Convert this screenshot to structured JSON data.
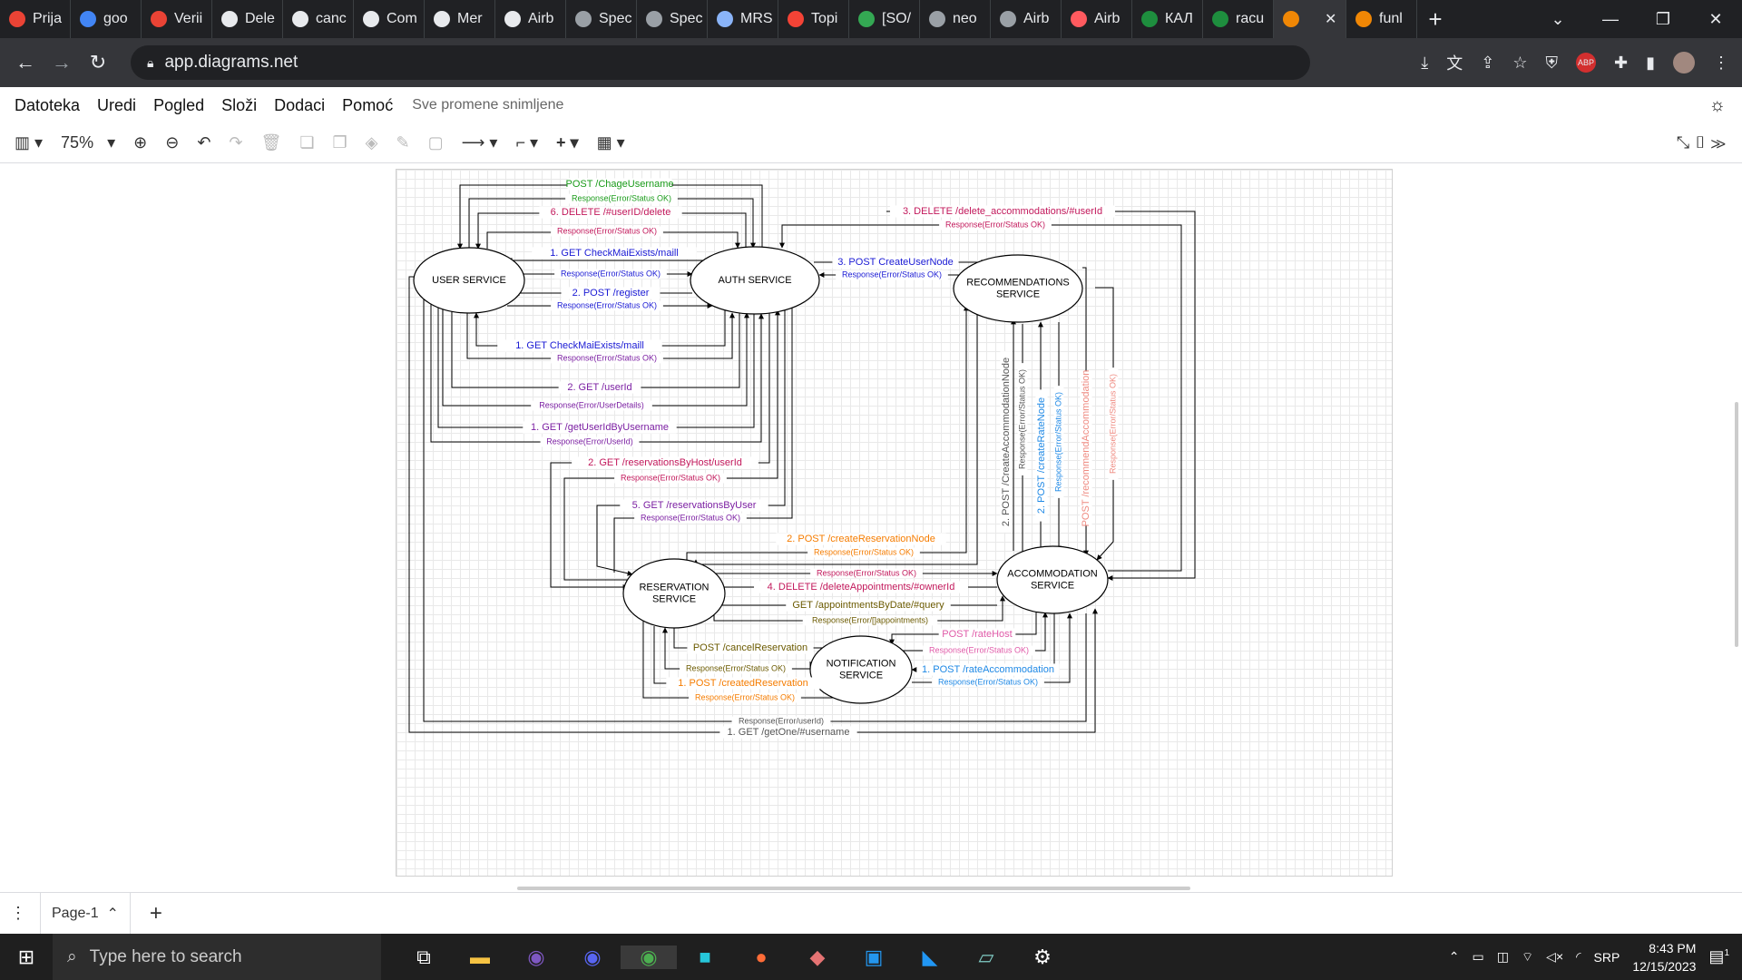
{
  "browser": {
    "tabs": [
      {
        "label": "Prija",
        "color": "#ea4335"
      },
      {
        "label": "goo",
        "color": "#4285f4"
      },
      {
        "label": "Verii",
        "color": "#ea4335"
      },
      {
        "label": "Dele",
        "color": "#e8eaed"
      },
      {
        "label": "canc",
        "color": "#e8eaed"
      },
      {
        "label": "Com",
        "color": "#e8eaed"
      },
      {
        "label": "Mer",
        "color": "#e8eaed"
      },
      {
        "label": "Airb",
        "color": "#e8eaed"
      },
      {
        "label": "Spec",
        "color": "#9aa0a6"
      },
      {
        "label": "Spec",
        "color": "#9aa0a6"
      },
      {
        "label": "MRS",
        "color": "#8ab4f8"
      },
      {
        "label": "Topi",
        "color": "#f44336"
      },
      {
        "label": "[SO/",
        "color": "#34a853"
      },
      {
        "label": "neo",
        "color": "#9aa0a6"
      },
      {
        "label": "Airb",
        "color": "#9aa0a6"
      },
      {
        "label": "Airb",
        "color": "#ff5a5f"
      },
      {
        "label": "КАЛ",
        "color": "#1e8e3e"
      },
      {
        "label": "racu",
        "color": "#1e8e3e"
      },
      {
        "label": "",
        "color": "#f08705"
      },
      {
        "label": "funl",
        "color": "#f08705"
      }
    ],
    "url": "app.diagrams.net"
  },
  "menu": {
    "items": [
      "Datoteka",
      "Uredi",
      "Pogled",
      "Složi",
      "Dodaci",
      "Pomoć"
    ],
    "saved_status": "Sve promene snimljene"
  },
  "toolbar": {
    "zoom": "75%"
  },
  "diagram": {
    "nodes": {
      "user": "USER SERVICE",
      "auth": "AUTH SERVICE",
      "reco": [
        "RECOMMENDATIONS",
        "SERVICE"
      ],
      "reservation": [
        "RESERVATION",
        "SERVICE"
      ],
      "accommodation": [
        "ACCOMMODATION",
        "SERVICE"
      ],
      "notification": [
        "NOTIFICATION",
        "SERVICE"
      ]
    },
    "labels": {
      "chage_username": "POST /ChageUsername",
      "chage_username_resp": "Response(Error/Status OK)",
      "delete_user": "6.  DELETE /#userID/delete",
      "delete_user_resp": "Response(Error/Status OK)",
      "check_mail_1": "1.  GET   CheckMaiExists/maill",
      "check_mail_1_resp": "Response(Error/Status OK)",
      "register": "2.  POST /register",
      "register_resp": "Response(Error/Status OK)",
      "check_mail_2": "1.  GET   CheckMaiExists/maill",
      "check_mail_2_resp": "Response(Error/Status OK)",
      "get_userid": "2.  GET /userId",
      "get_userid_resp": "Response(Error/UserDetails)",
      "get_userid_by_username": "1.  GET /getUserIdByUsername",
      "get_userid_by_username_resp": "Response(Error/UserId)",
      "reservations_by_host": "2.  GET /reservationsByHost/userId",
      "reservations_by_host_resp": "Response(Error/Status OK)",
      "reservations_by_user": "5.  GET /reservationsByUser",
      "reservations_by_user_resp": "Response(Error/Status OK)",
      "delete_accommodations": "3.  DELETE /delete_accommodations/#userId",
      "delete_accommodations_resp": "Response(Error/Status OK)",
      "create_user_node": "3.  POST CreateUserNode",
      "create_user_node_resp": "Response(Error/Status OK)",
      "create_accommodation_node": "2.  POST /CreateAccommodationNode",
      "create_accommodation_node_resp": "Response(Error/Status OK)",
      "create_rate_node": "2.  POST /createRateNode",
      "create_rate_node_resp": "Response(Error/Status OK)",
      "recommend_accommodation": "POST /recommendAccommodation",
      "recommend_accommodation_resp": "Response(Error/Status OK)",
      "create_reservation_node": "2.  POST /createReservationNode",
      "create_reservation_node_resp": "Response(Error/Status OK)",
      "res_acc_resp": "Response(Error/Status OK)",
      "delete_appointments": "4.  DELETE /deleteAppointments/#ownerId",
      "appointments_by_date": "GET /appointmentsByDate/#query",
      "appointments_by_date_resp": "Response(Error/[]appointments)",
      "rate_host": "POST /rateHost",
      "rate_host_resp": "Response(Error/Status OK)",
      "rate_accommodation": "1. POST /rateAccommodation",
      "rate_accommodation_resp": "Response(Error/Status OK)",
      "cancel_reservation": "POST /cancelReservation",
      "cancel_reservation_resp": "Response(Error/Status OK)",
      "created_reservation": "1.  POST /createdReservation",
      "created_reservation_resp": "Response(Error/Status OK)",
      "get_one_resp": "Response(Error/userId)",
      "get_one": "1.  GET /getOne/#username"
    },
    "colors": {
      "green": "#1a9b1a",
      "magenta": "#c2185b",
      "blue": "#1a1ad4",
      "purple": "#7b1fa2",
      "orange": "#f57c00",
      "olive": "#6b5a00",
      "pink": "#e05aa8",
      "skyblue": "#1e88e5",
      "salmon": "#ef8a80",
      "gray": "#555555"
    }
  },
  "pages": {
    "current": "Page-1"
  },
  "taskbar": {
    "search_placeholder": "Type here to search",
    "language": "SRP",
    "time": "8:43 PM",
    "date": "12/15/2023",
    "notifications": "1"
  }
}
